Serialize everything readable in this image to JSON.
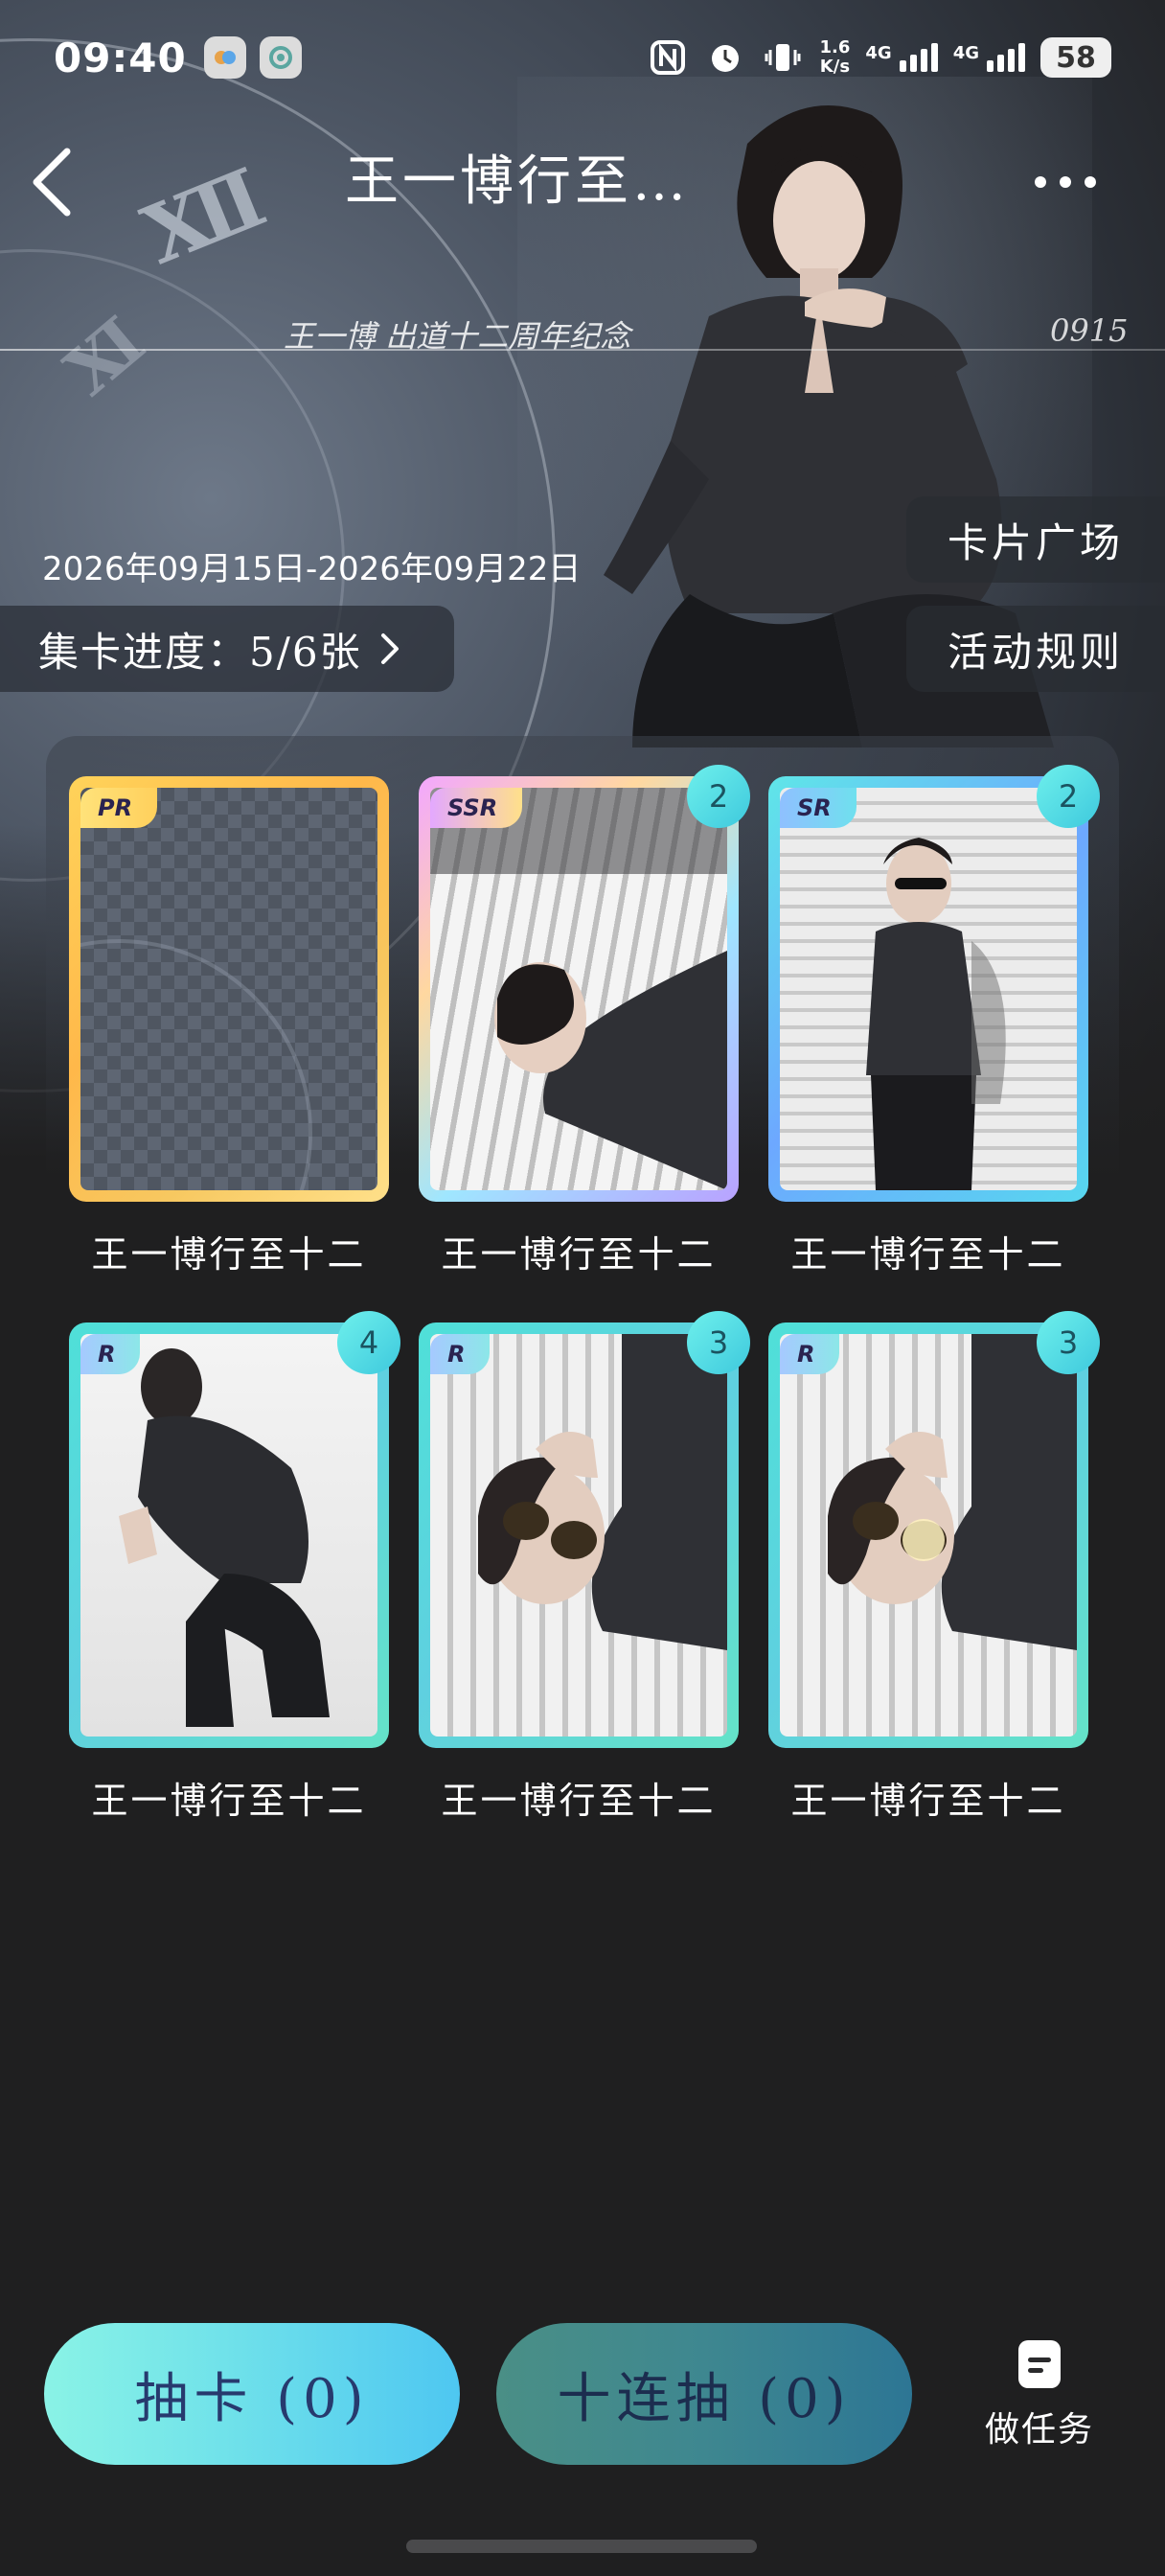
{
  "status_bar": {
    "time": "09:40",
    "net_speed_top": "1.6",
    "net_speed_bottom": "K/s",
    "sim1": "4G",
    "sim2": "4G",
    "battery": "58"
  },
  "header": {
    "title": "王一博行至…",
    "back_icon": "chevron-left-icon",
    "more_icon": "more-dots-icon"
  },
  "banner": {
    "anniversary_text": "王一博    出道十二周年纪念",
    "code": "0915",
    "date_range": "2026年09月15日-2026年09月22日",
    "progress_label": "集卡进度：5/6张"
  },
  "side_buttons": {
    "card_square": "卡片广场",
    "event_rules": "活动规则"
  },
  "cards": [
    {
      "rarity": "PR",
      "name": "王一博行至十二",
      "count": "",
      "frame": "gold",
      "locked": true
    },
    {
      "rarity": "SSR",
      "name": "王一博行至十二",
      "count": "2",
      "frame": "rainbow",
      "locked": false
    },
    {
      "rarity": "SR",
      "name": "王一博行至十二",
      "count": "2",
      "frame": "blue",
      "locked": false
    },
    {
      "rarity": "R",
      "name": "王一博行至十二",
      "count": "4",
      "frame": "teal",
      "locked": false
    },
    {
      "rarity": "R",
      "name": "王一博行至十二",
      "count": "3",
      "frame": "teal",
      "locked": false
    },
    {
      "rarity": "R",
      "name": "王一博行至十二",
      "count": "3",
      "frame": "teal",
      "locked": false
    }
  ],
  "bottom": {
    "draw_label": "抽卡 (0)",
    "draw10_label": "十连抽 (0)",
    "task_label": "做任务"
  },
  "colors": {
    "background": "#1f1f20",
    "accent_teal": "#6fe1ea",
    "badge": "#3ec9dd"
  }
}
